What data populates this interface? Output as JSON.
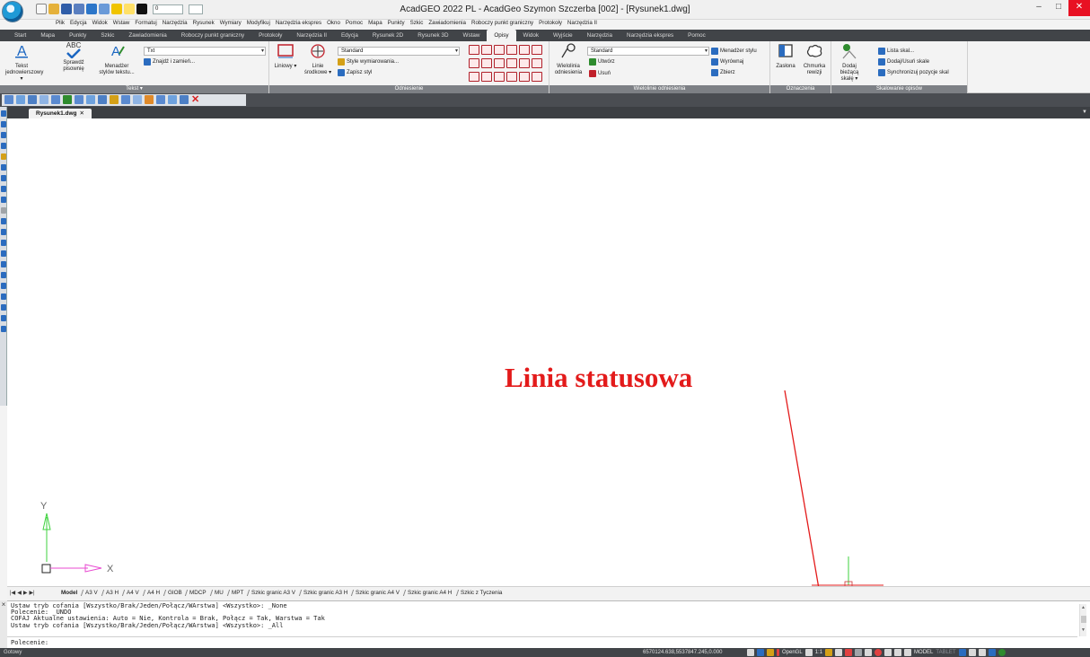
{
  "window": {
    "title": "AcadGEO 2022 PL - AcadGeo Szymon Szczerba [002] - [Rysunek1.dwg]",
    "layer_value": "0",
    "minimize": "–",
    "maximize": "□",
    "close": "✕"
  },
  "menubar": [
    "Plik",
    "Edycja",
    "Widok",
    "Wstaw",
    "Formatuj",
    "Narzędzia",
    "Rysunek",
    "Wymiary",
    "Modyfikuj",
    "Narzędzia ekspres",
    "Okno",
    "Pomoc",
    "Mapa",
    "Punkty",
    "Szkic",
    "Zawiadomienia",
    "Roboczy punkt graniczny",
    "Protokoły",
    "Narzędzia II"
  ],
  "ribbon_tabs": [
    "Start",
    "Mapa",
    "Punkty",
    "Szkic",
    "Zawiadomienia",
    "Roboczy punkt graniczny",
    "Protokoły",
    "Narzędzia II",
    "Edycja",
    "Rysunek 2D",
    "Rysunek 3D",
    "Wstaw",
    "Opisy",
    "Widok",
    "Wyjście",
    "Narzędzia",
    "Narzędzia ekspres",
    "Pomoc"
  ],
  "active_ribbon_tab": "Opisy",
  "ribbon": {
    "tekst": {
      "title": "Tekst ▾",
      "big1": "Tekst jednowierszowy ▾",
      "big2": "Sprawdź pisownię",
      "big3": "Menadżer stylów tekstu...",
      "big2_icon_text": "ABC",
      "style_combo": "Txt",
      "find": "Znajdź i zamień..."
    },
    "wymiar": {
      "big1": "Liniowy ▾",
      "big2": "Linie środkowe ▾",
      "combo": "Standard",
      "row1": "Style wymiarowania...",
      "row2": "Zapisz styl",
      "title": "Odniesienie"
    },
    "wielolinie": {
      "big": "Wielolinia odniesienia",
      "combo": "Standard",
      "row1": "Utwórz",
      "row2": "Usuń",
      "rowr1": "Menadżer stylu",
      "rowr2": "Wyrównaj",
      "rowr3": "Zbierz",
      "title": "Wielolinie odniesienia"
    },
    "oznaczenia": {
      "big1": "Zasłona",
      "big2": "Chmurka rewizji",
      "title": "Oznaczenia"
    },
    "skalowanie": {
      "big": "Dodaj bieżącą skalę ▾",
      "row1": "Lista skal...",
      "row2": "Dodaj/Usuń skale",
      "row3": "Synchronizuj pozycje skal",
      "title": "Skalowanie opisów"
    }
  },
  "document_tab": {
    "name": "Rysunek1.dwg",
    "close": "✕"
  },
  "annotation": "Linia statusowa",
  "ucs": {
    "x_label": "X",
    "y_label": "Y"
  },
  "layout_nav": [
    "|◀",
    "◀",
    "▶",
    "▶|"
  ],
  "layout_tabs": [
    "Model",
    "A3 V",
    "A3 H",
    "A4 V",
    "A4 H",
    "GIOB",
    "MDCP",
    "MU",
    "MPT",
    "Szkic granic A3 V",
    "Szkic granic A3 H",
    "Szkic granic A4 V",
    "Szkic granic A4 H",
    "Szkic z Tyczenia"
  ],
  "command": {
    "history": [
      "Ustaw tryb cofania [Wszystko/Brak/Jeden/Połącz/WArstwa] <Wszystko>: _None",
      "Polecenie: _UNDO",
      "COFAJ Aktualne ustawienia: Auto = Nie, Kontrola = Brak, Połącz = Tak, Warstwa = Tak",
      "Ustaw tryb cofania [Wszystko/Brak/Jeden/Połącz/WArstwa] <Wszystko>: _All"
    ],
    "prompt": "Polecenie:"
  },
  "status": {
    "ready": "Gotowy",
    "coords": "6570124.638,5537847.245,0.000",
    "opengl": "OpenGL",
    "scale": "1:1",
    "model": "MODEL",
    "tablet": "TABLET"
  },
  "colors": {
    "annotation_red": "#e31b1b",
    "ucs_green": "#3fd23f",
    "ribbon_dark": "#414448"
  }
}
